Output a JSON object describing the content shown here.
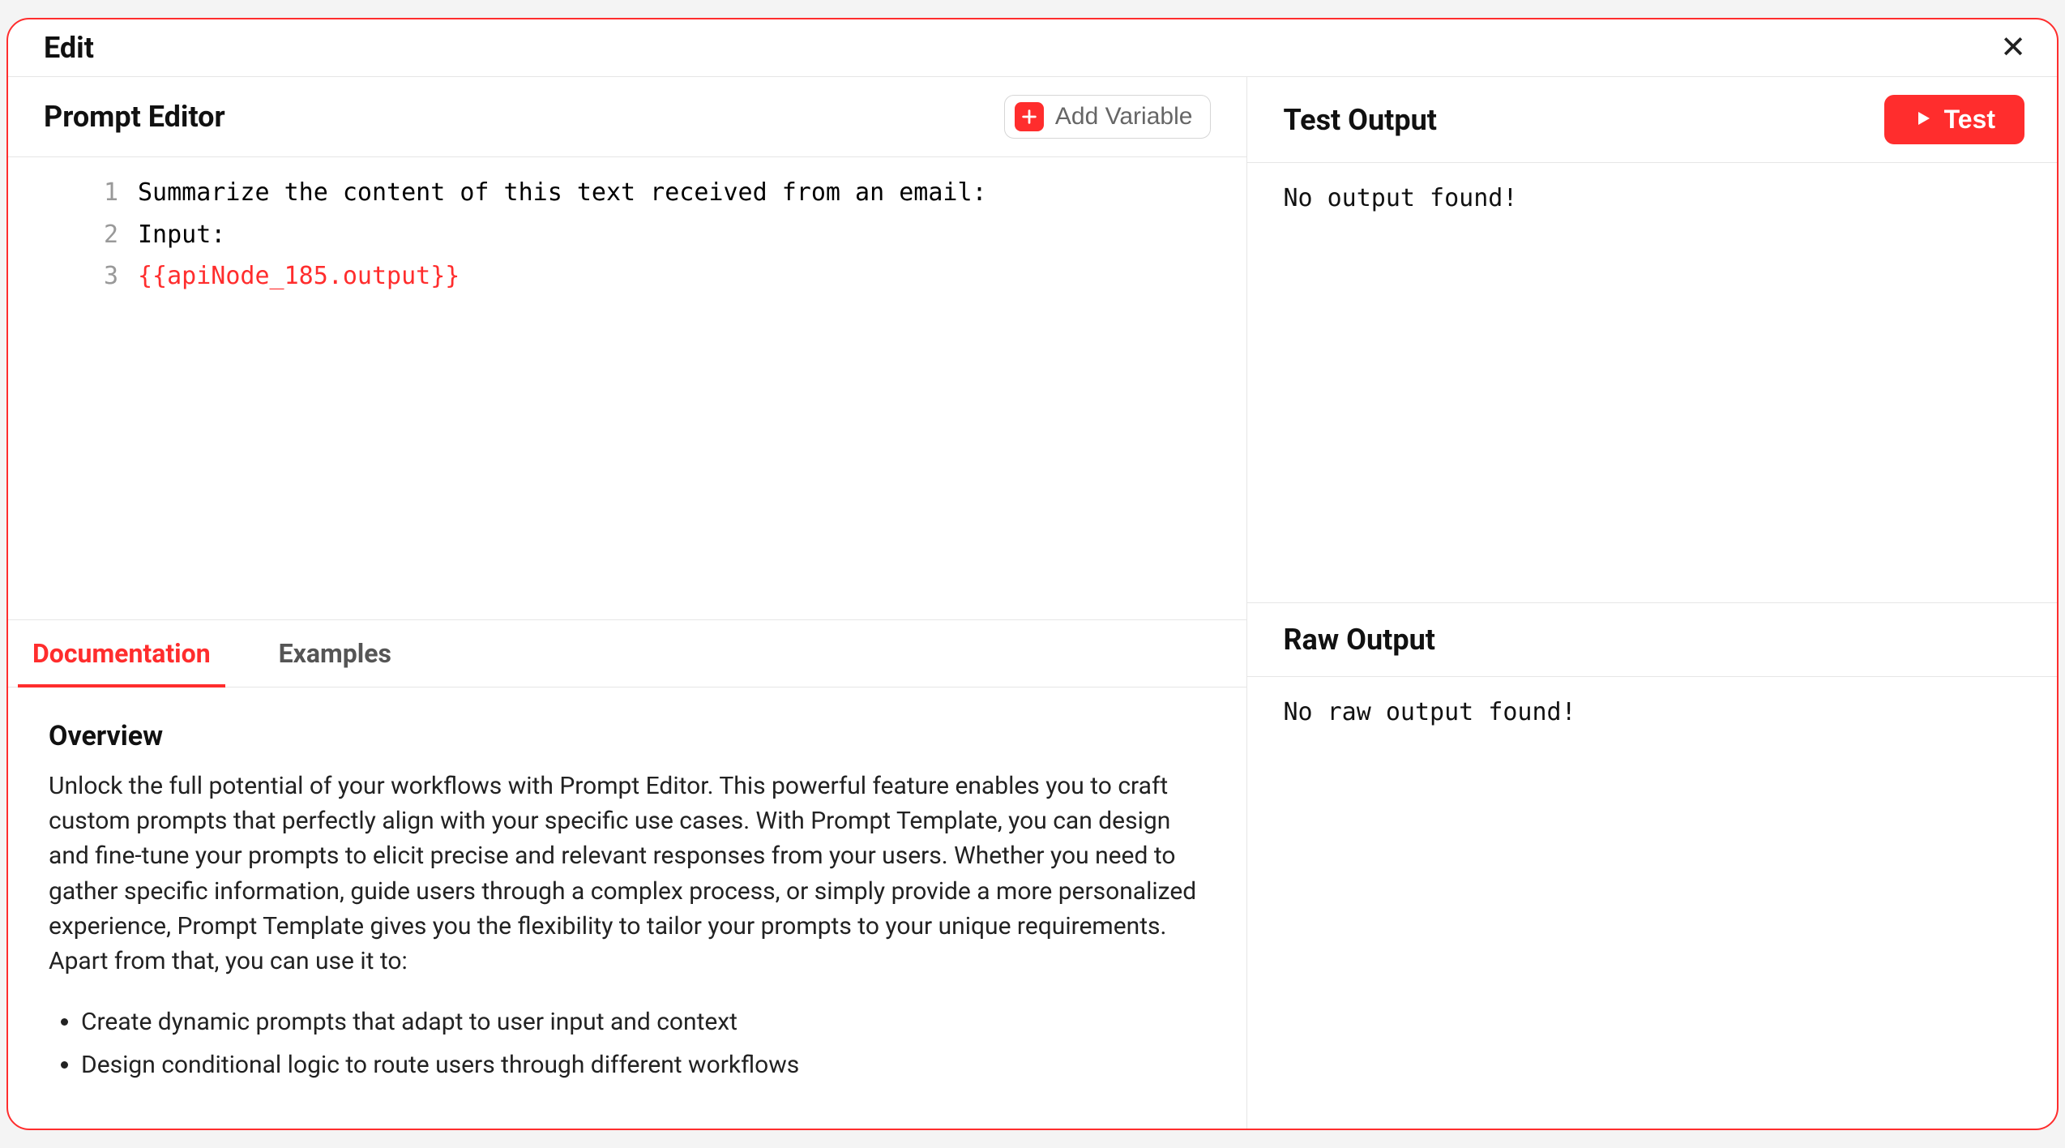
{
  "modal": {
    "title": "Edit"
  },
  "promptEditor": {
    "title": "Prompt Editor",
    "addVariableLabel": "Add Variable",
    "lines": [
      {
        "n": "1",
        "text": "Summarize the content of this text received from an email:",
        "variable": false
      },
      {
        "n": "2",
        "text": "Input:",
        "variable": false
      },
      {
        "n": "3",
        "text": "{{apiNode_185.output}}",
        "variable": true
      }
    ]
  },
  "tabs": {
    "documentation": "Documentation",
    "examples": "Examples"
  },
  "documentation": {
    "heading": "Overview",
    "paragraph": "Unlock the full potential of your workflows with Prompt Editor. This powerful feature enables you to craft custom prompts that perfectly align with your specific use cases. With Prompt Template, you can design and fine-tune your prompts to elicit precise and relevant responses from your users. Whether you need to gather specific information, guide users through a complex process, or simply provide a more personalized experience, Prompt Template gives you the flexibility to tailor your prompts to your unique requirements. Apart from that, you can use it to:",
    "bullets": [
      "Create dynamic prompts that adapt to user input and context",
      "Design conditional logic to route users through different workflows"
    ]
  },
  "testOutput": {
    "title": "Test Output",
    "buttonLabel": "Test",
    "body": "No output found!"
  },
  "rawOutput": {
    "title": "Raw Output",
    "body": "No raw output found!"
  }
}
